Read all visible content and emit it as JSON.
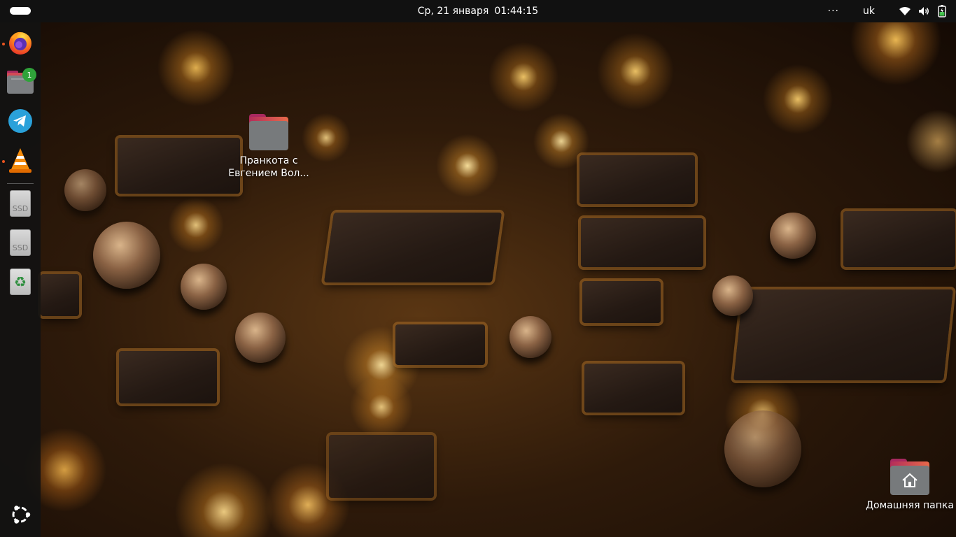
{
  "topbar": {
    "date": "Ср, 21 января",
    "time": "01:44:15",
    "overflow": "···",
    "language": "uk",
    "icons": [
      "wifi-icon",
      "volume-icon",
      "battery-icon"
    ]
  },
  "dock": {
    "items": [
      {
        "name": "firefox",
        "icon": "firefox-icon",
        "running": true
      },
      {
        "name": "files",
        "icon": "files-icon",
        "badge": "1"
      },
      {
        "name": "telegram",
        "icon": "telegram-icon"
      },
      {
        "name": "vlc",
        "icon": "vlc-icon",
        "running": true
      },
      {
        "name": "ssd-drive-1",
        "icon": "drive-icon",
        "label": "SSD"
      },
      {
        "name": "ssd-drive-2",
        "icon": "drive-icon",
        "label": "SSD"
      },
      {
        "name": "trash",
        "icon": "trash-icon"
      },
      {
        "name": "show-apps",
        "icon": "ubuntu-logo-icon"
      }
    ],
    "accent_color": "#e95420"
  },
  "desktop": {
    "folder": {
      "label_line1": "Пранкота с",
      "label_line2": "Евгением Вол..."
    },
    "home": {
      "label": "Домашняя папка"
    }
  }
}
